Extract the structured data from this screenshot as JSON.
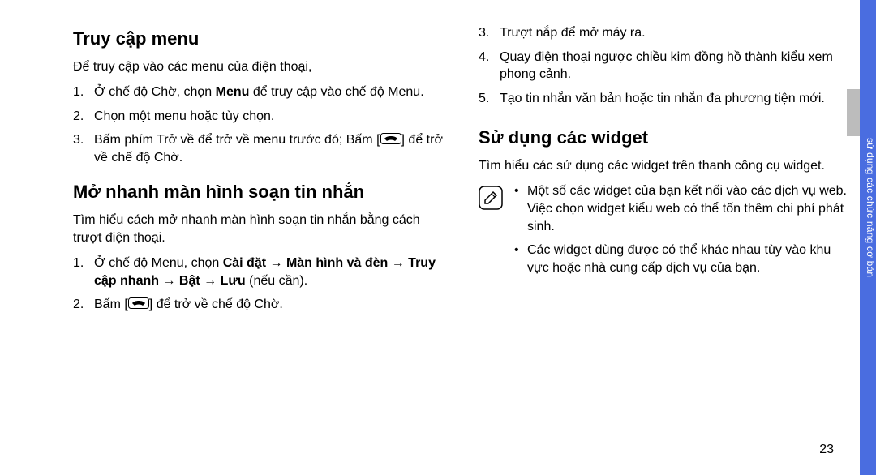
{
  "side_label": "sử dụng các chức năng cơ bản",
  "page_number": "23",
  "icon_names": {
    "note": "pencil-note-icon",
    "end": "end-call-icon"
  },
  "col1": {
    "h1": "Truy cập menu",
    "p1": "Để truy cập vào các menu của điện thoại,",
    "list1": [
      {
        "num": "1.",
        "pre": "Ở chế độ Chờ, chọn ",
        "bold": "Menu",
        "post": " để truy cập vào chế độ Menu."
      },
      {
        "num": "2.",
        "text": "Chọn một menu hoặc tùy chọn."
      },
      {
        "num": "3.",
        "pre": "Bấm phím Trở về để trở về menu trước đó; Bấm  [",
        "post": "] để trở về chế độ Chờ."
      }
    ],
    "h2": "Mở nhanh màn hình soạn tin nhắn",
    "p2": "Tìm hiểu cách mở nhanh màn hình soạn tin nhắn bằng cách trượt điện thoại.",
    "list2": [
      {
        "num": "1.",
        "pre": "Ở chế độ Menu, chọn ",
        "bold": "Cài đặt → Màn hình và đèn → Truy cập nhanh → Bật → Lưu",
        "post": " (nếu cần)."
      },
      {
        "num": "2.",
        "pre": "Bấm [",
        "post": "] để trở về chế độ Chờ."
      }
    ]
  },
  "col2": {
    "list3": [
      {
        "num": "3.",
        "text": "Trượt nắp để mở máy ra."
      },
      {
        "num": "4.",
        "text": "Quay điện thoại ngược chiều kim đồng hồ thành kiểu xem phong cảnh."
      },
      {
        "num": "5.",
        "text": "Tạo tin nhắn văn bản hoặc tin nhắn đa phương tiện mới."
      }
    ],
    "h3": "Sử dụng các widget",
    "p3": "Tìm hiểu các sử dụng các widget trên thanh công cụ widget.",
    "note": [
      "Một số các widget của bạn kết nối vào các dịch vụ web. Việc chọn widget kiểu web có thể tốn thêm chi phí phát sinh.",
      "Các widget dùng được có thể khác nhau tùy vào khu vực hoặc nhà cung cấp dịch vụ của bạn."
    ]
  }
}
